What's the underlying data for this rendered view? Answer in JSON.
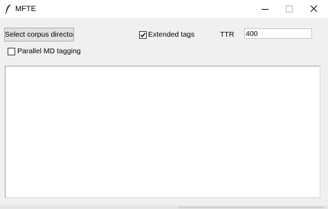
{
  "window": {
    "title": "MFTE",
    "icon": "feather-icon",
    "controls": [
      "minimize-icon",
      "maximize-icon",
      "close-icon"
    ]
  },
  "controls": {
    "select_corpus_label": "Select corpus directory",
    "extended_tags": {
      "label": "Extended tags",
      "checked": true
    },
    "parallel_md": {
      "label": "Parallel MD tagging",
      "checked": false
    },
    "ttr_label": "TTR",
    "ttr_value": "400"
  },
  "output": {
    "text": ""
  }
}
